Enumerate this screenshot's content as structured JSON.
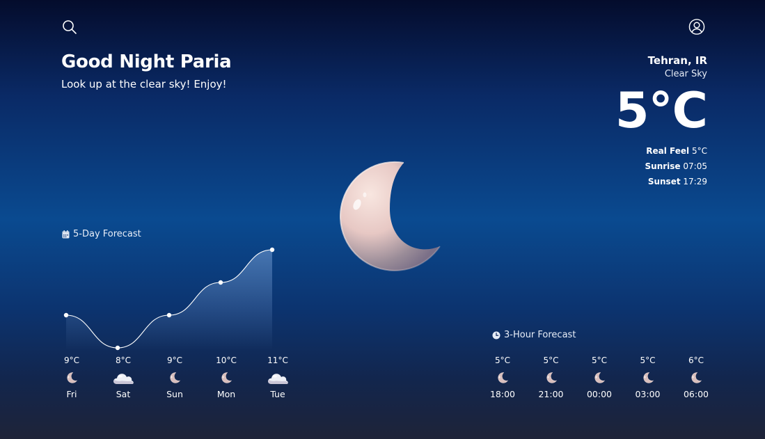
{
  "header": {
    "search_icon": "search-icon",
    "profile_icon": "user-circle-icon"
  },
  "greeting": {
    "title": "Good Night Paria",
    "subtitle": "Look up at the clear sky! Enjoy!"
  },
  "current": {
    "location": "Tehran, IR",
    "condition": "Clear Sky",
    "temperature": "5°C",
    "real_feel_label": "Real Feel",
    "real_feel_value": "5°C",
    "sunrise_label": "Sunrise",
    "sunrise_value": "07:05",
    "sunset_label": "Sunset",
    "sunset_value": "17:29",
    "illustration": "crescent-moon"
  },
  "five_day": {
    "title": "5-Day Forecast",
    "icon": "calendar-icon",
    "days": [
      {
        "day": "Fri",
        "temp_label": "9°C",
        "temp": 9,
        "icon": "moon"
      },
      {
        "day": "Sat",
        "temp_label": "8°C",
        "temp": 8,
        "icon": "cloud"
      },
      {
        "day": "Sun",
        "temp_label": "9°C",
        "temp": 9,
        "icon": "moon"
      },
      {
        "day": "Mon",
        "temp_label": "10°C",
        "temp": 10,
        "icon": "moon"
      },
      {
        "day": "Tue",
        "temp_label": "11°C",
        "temp": 11,
        "icon": "cloud"
      }
    ]
  },
  "three_hour": {
    "title": "3-Hour Forecast",
    "icon": "clock-icon",
    "slots": [
      {
        "time": "18:00",
        "temp_label": "5°C",
        "icon": "moon"
      },
      {
        "time": "21:00",
        "temp_label": "5°C",
        "icon": "moon"
      },
      {
        "time": "00:00",
        "temp_label": "5°C",
        "icon": "moon"
      },
      {
        "time": "03:00",
        "temp_label": "5°C",
        "icon": "moon"
      },
      {
        "time": "06:00",
        "temp_label": "6°C",
        "icon": "moon"
      }
    ]
  },
  "colors": {
    "text": "#ffffff",
    "moon_light": "#f4dcd6",
    "moon_shadow": "#8a7f8e"
  }
}
